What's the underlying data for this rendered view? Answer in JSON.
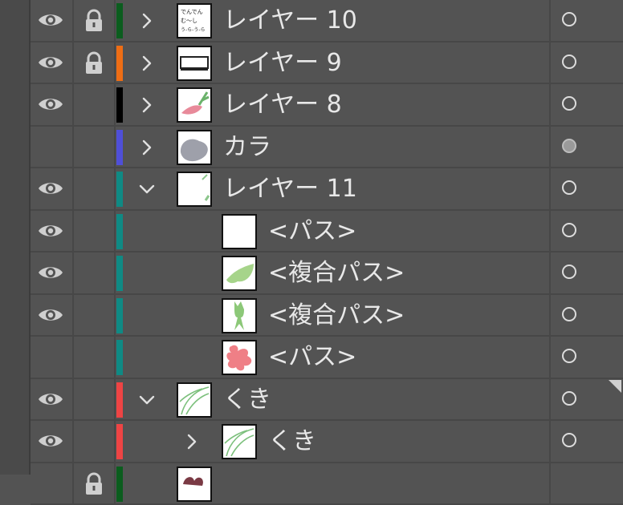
{
  "colors": {
    "panel_bg": "#535353",
    "row_sep": "#474747",
    "text": "#e8e8e8"
  },
  "layers": [
    {
      "name": "レイヤー 10",
      "visible": true,
      "locked": true,
      "color": "#0b5d1e",
      "expanded": false,
      "indent": 0,
      "thumb": "text-note",
      "target": "hollow"
    },
    {
      "name": "レイヤー 9",
      "visible": true,
      "locked": true,
      "color": "#ee6d14",
      "expanded": false,
      "indent": 0,
      "thumb": "frame",
      "target": "hollow"
    },
    {
      "name": "レイヤー 8",
      "visible": true,
      "locked": false,
      "color": "#000000",
      "expanded": false,
      "indent": 0,
      "thumb": "flower-pink",
      "target": "hollow"
    },
    {
      "name": "カラ",
      "visible": false,
      "locked": false,
      "color": "#4f4fd8",
      "expanded": false,
      "indent": 0,
      "thumb": "gray-blob",
      "target": "filled"
    },
    {
      "name": "レイヤー 11",
      "visible": true,
      "locked": false,
      "color": "#0f8a84",
      "expanded": true,
      "indent": 0,
      "thumb": "leaf-corner",
      "target": "hollow"
    },
    {
      "name": "<パス>",
      "visible": true,
      "locked": false,
      "color": "#0f8a84",
      "expanded": null,
      "indent": 1,
      "thumb": "blank",
      "target": "hollow"
    },
    {
      "name": "<複合パス>",
      "visible": true,
      "locked": false,
      "color": "#0f8a84",
      "expanded": null,
      "indent": 1,
      "thumb": "green-leaf",
      "target": "hollow"
    },
    {
      "name": "<複合パス>",
      "visible": true,
      "locked": false,
      "color": "#0f8a84",
      "expanded": null,
      "indent": 1,
      "thumb": "green-tulip",
      "target": "hollow"
    },
    {
      "name": "<パス>",
      "visible": false,
      "locked": false,
      "color": "#0f8a84",
      "expanded": null,
      "indent": 1,
      "thumb": "pink-blob",
      "target": "hollow"
    },
    {
      "name": "くき",
      "visible": true,
      "locked": false,
      "color": "#ee4444",
      "expanded": true,
      "indent": 0,
      "thumb": "stems",
      "target": "hollow"
    },
    {
      "name": "くき",
      "visible": true,
      "locked": false,
      "color": "#ee4444",
      "expanded": false,
      "indent": 1,
      "thumb": "stems",
      "target": "hollow"
    },
    {
      "name": "",
      "visible": false,
      "locked": true,
      "color": "#0b5d1e",
      "expanded": null,
      "indent": 0,
      "thumb": "partial",
      "target": "none"
    }
  ],
  "thumb_text": {
    "line1": "でんでん",
    "line2": "む〜し",
    "line3": "う-ら-う-ら"
  }
}
